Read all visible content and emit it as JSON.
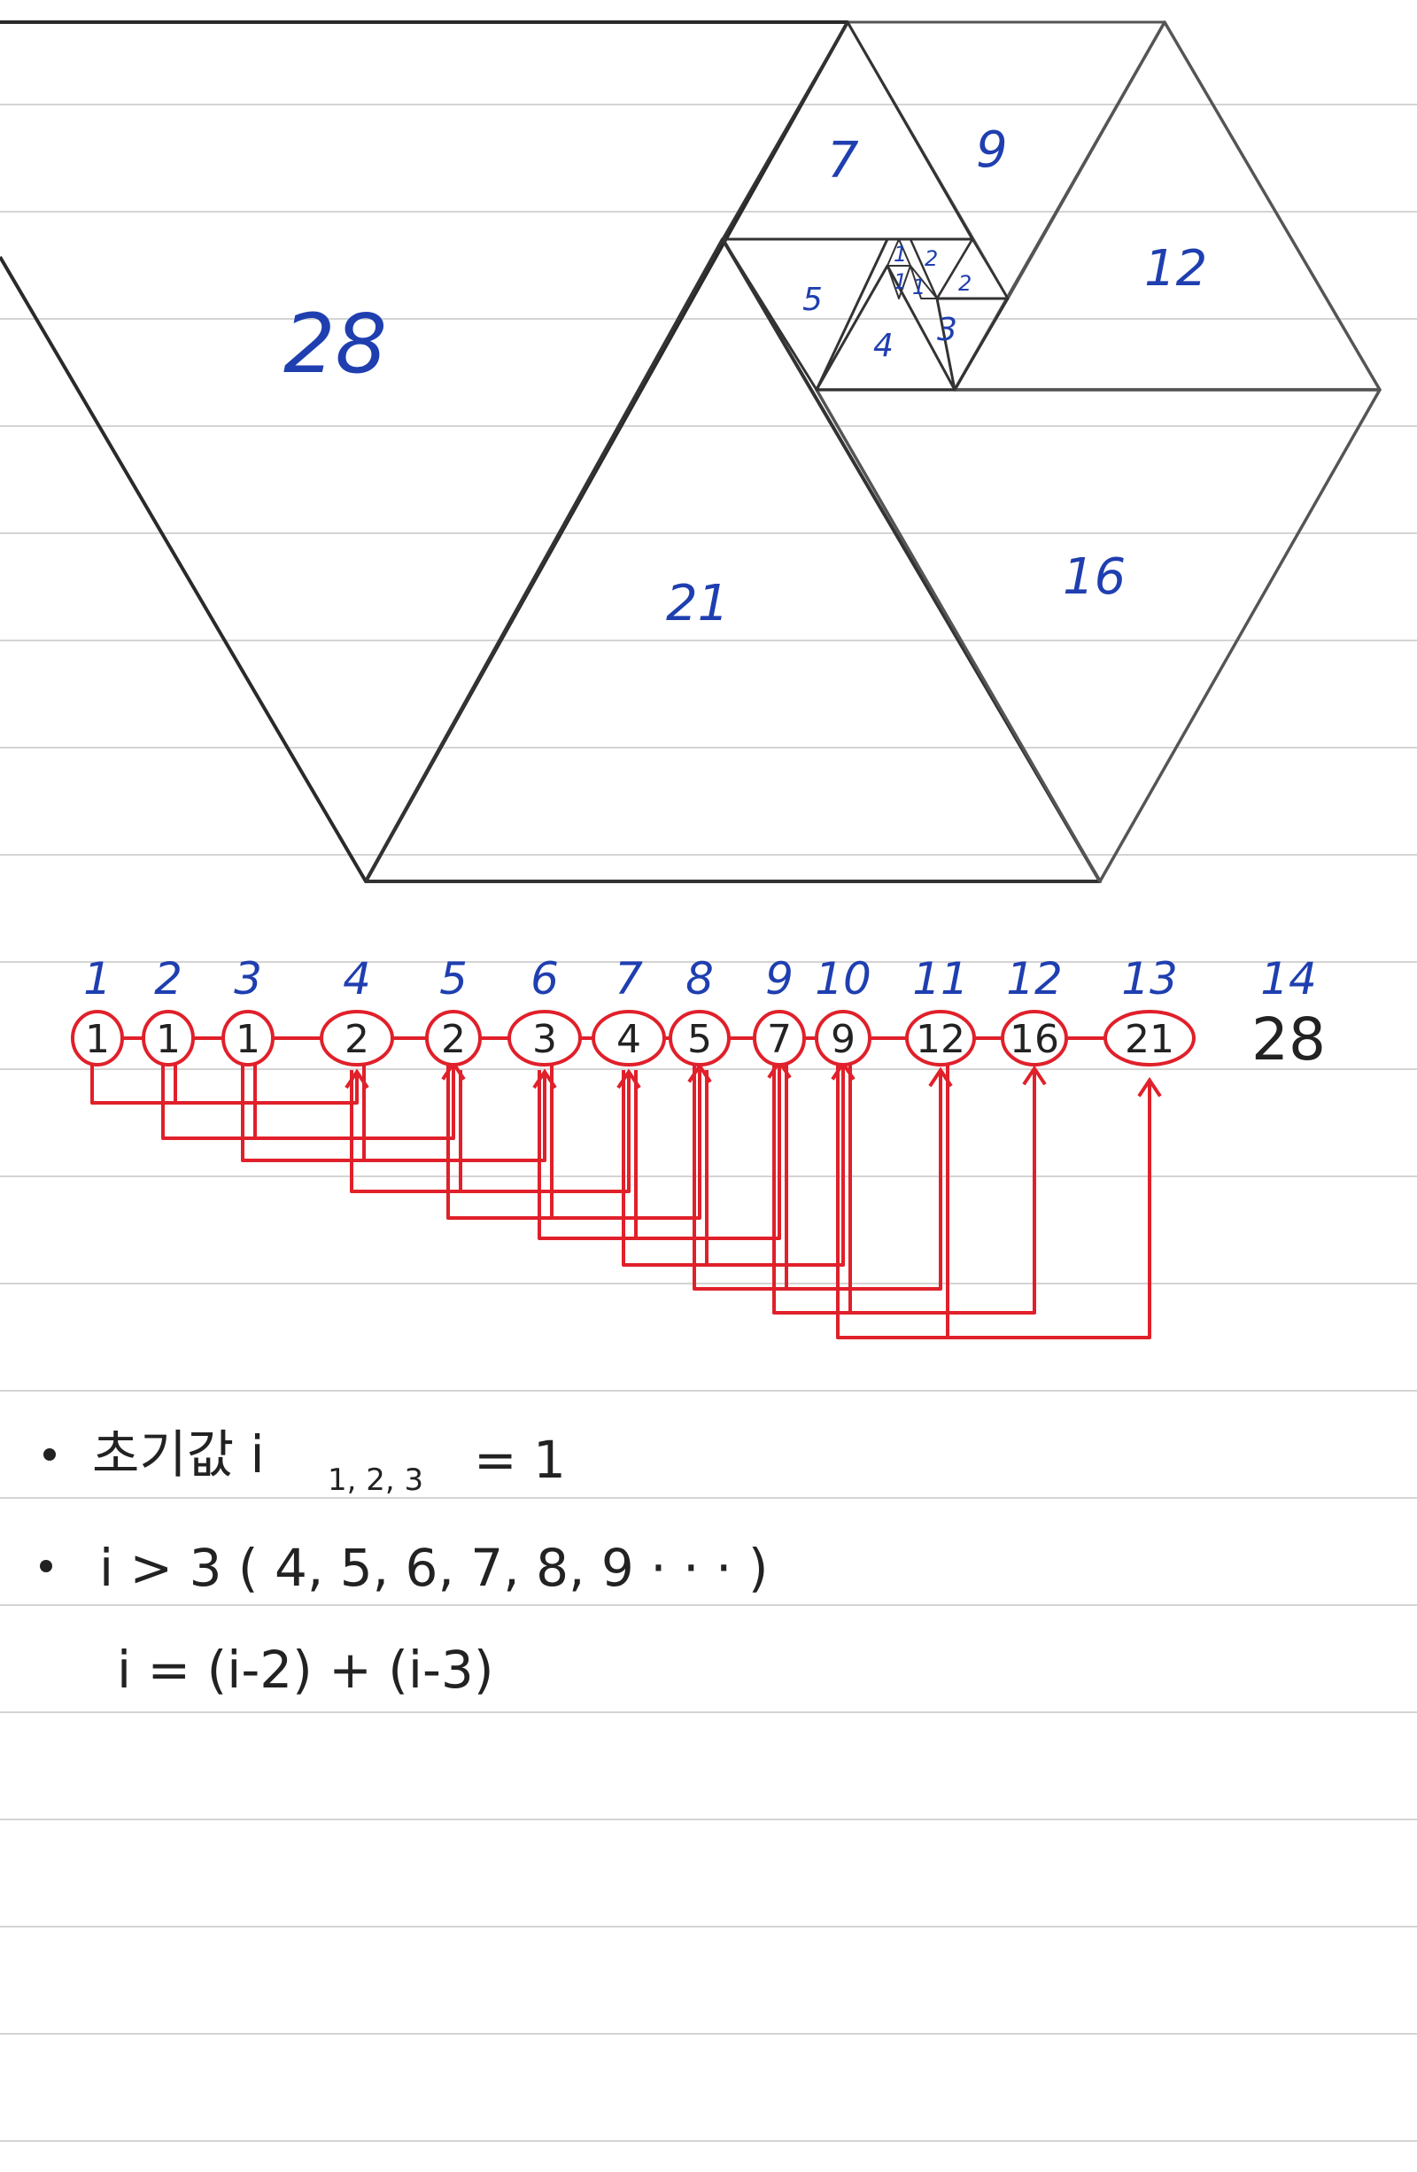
{
  "colors": {
    "ink": "#222222",
    "pen_blue": "#1f3fb0",
    "pen_red": "#e0202a",
    "rule_line": "#d4d4d4"
  },
  "triangle_labels": [
    "28",
    "21",
    "16",
    "12",
    "9",
    "7",
    "5",
    "4",
    "3",
    "2",
    "2",
    "1",
    "1",
    "1"
  ],
  "sequence": {
    "indices": [
      "1",
      "2",
      "3",
      "4",
      "5",
      "6",
      "7",
      "8",
      "9",
      "10",
      "11",
      "12",
      "13",
      "14"
    ],
    "values": [
      "1",
      "1",
      "1",
      "2",
      "2",
      "3",
      "4",
      "5",
      "7",
      "9",
      "12",
      "16",
      "21",
      "28"
    ]
  },
  "notes": {
    "line1_main": "초기값 i",
    "line1_sub": "1, 2, 3",
    "line1_rest": "= 1",
    "line2": "i > 3 ( 4, 5, 6, 7, 8, 9 · · · )",
    "line3": "i = (i-2) + (i-3)"
  }
}
